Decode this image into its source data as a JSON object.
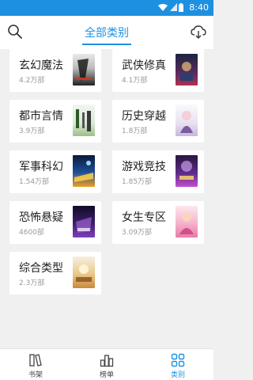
{
  "status_bar": {
    "time": "8:40"
  },
  "header": {
    "title": "全部类别"
  },
  "categories": [
    {
      "name": "玄幻魔法",
      "count": "4.2万部"
    },
    {
      "name": "武侠修真",
      "count": "4.1万部"
    },
    {
      "name": "都市言情",
      "count": "3.9万部"
    },
    {
      "name": "历史穿越",
      "count": "1.8万部"
    },
    {
      "name": "军事科幻",
      "count": "1.54万部"
    },
    {
      "name": "游戏竞技",
      "count": "1.85万部"
    },
    {
      "name": "恐怖悬疑",
      "count": "4600部"
    },
    {
      "name": "女生专区",
      "count": "3.09万部"
    },
    {
      "name": "综合类型",
      "count": "2.3万部"
    }
  ],
  "tabs": [
    {
      "label": "书架"
    },
    {
      "label": "榜单"
    },
    {
      "label": "类别"
    }
  ],
  "colors": {
    "accent": "#1e90e0",
    "background": "#f0f0f0"
  }
}
